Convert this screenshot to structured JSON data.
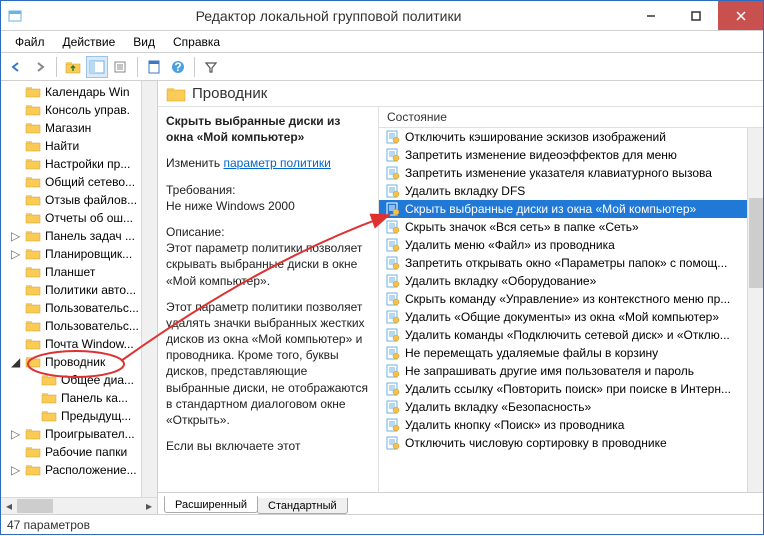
{
  "window": {
    "title": "Редактор локальной групповой политики"
  },
  "menu": {
    "file": "Файл",
    "action": "Действие",
    "view": "Вид",
    "help": "Справка"
  },
  "tree": {
    "items": [
      {
        "t": 0,
        "label": "Календарь Win"
      },
      {
        "t": 0,
        "label": "Консоль управ."
      },
      {
        "t": 0,
        "label": "Магазин"
      },
      {
        "t": 0,
        "label": "Найти"
      },
      {
        "t": 0,
        "label": "Настройки пр..."
      },
      {
        "t": 0,
        "label": "Общий сетево..."
      },
      {
        "t": 0,
        "label": "Отзыв файлов..."
      },
      {
        "t": 0,
        "label": "Отчеты об ош..."
      },
      {
        "t": 1,
        "label": "Панель задач ..."
      },
      {
        "t": 1,
        "label": "Планировщик..."
      },
      {
        "t": 0,
        "label": "Планшет"
      },
      {
        "t": 0,
        "label": "Политики авто..."
      },
      {
        "t": 0,
        "label": "Пользовательс..."
      },
      {
        "t": 0,
        "label": "Пользовательс..."
      },
      {
        "t": 0,
        "label": "Почта Window..."
      },
      {
        "t": 2,
        "label": "Проводник",
        "sel": true
      },
      {
        "t": 0,
        "label": "Общее диа...",
        "indent": true
      },
      {
        "t": 0,
        "label": "Панель ка...",
        "indent": true
      },
      {
        "t": 0,
        "label": "Предыдущ...",
        "indent": true
      },
      {
        "t": 1,
        "label": "Проигрывател..."
      },
      {
        "t": 0,
        "label": "Рабочие папки"
      },
      {
        "t": 1,
        "label": "Расположение..."
      }
    ]
  },
  "details": {
    "header": "Проводник",
    "policy_title": "Скрыть выбранные диски из окна «Мой компьютер»",
    "edit_label": "Изменить",
    "edit_link": "параметр политики",
    "req_label": "Требования:",
    "req_value": "Не ниже Windows 2000",
    "desc_label": "Описание:",
    "desc1": "Этот параметр политики позволяет скрывать выбранные диски в окне «Мой компьютер».",
    "desc2": "Этот параметр политики позволяет удалять значки выбранных жестких дисков из окна «Мой компьютер» и проводника. Кроме того, буквы дисков, представляющие выбранные диски, не отображаются в стандартном диалоговом окне «Открыть».",
    "desc3": "Если вы включаете этот"
  },
  "list": {
    "header": "Состояние",
    "items": [
      "Отключить кэширование эскизов изображений",
      "Запретить изменение видеоэффектов для меню",
      "Запретить изменение указателя клавиатурного вызова",
      "Удалить вкладку DFS",
      "Скрыть выбранные диски из окна «Мой компьютер»",
      "Скрыть значок «Вся сеть» в папке «Сеть»",
      "Удалить меню «Файл» из проводника",
      "Запретить открывать окно «Параметры папок» с помощ...",
      "Удалить вкладку «Оборудование»",
      "Скрыть команду «Управление» из контекстного меню пр...",
      "Удалить «Общие документы» из окна «Мой компьютер»",
      "Удалить команды «Подключить сетевой диск» и «Отклю...",
      "Не перемещать удаляемые файлы в корзину",
      "Не запрашивать другие имя пользователя и пароль",
      "Удалить ссылку «Повторить поиск» при поиске в Интерн...",
      "Удалить вкладку «Безопасность»",
      "Удалить кнопку «Поиск» из проводника",
      "Отключить числовую сортировку в проводнике"
    ],
    "selected_index": 4
  },
  "tabs": {
    "extended": "Расширенный",
    "standard": "Стандартный"
  },
  "status": {
    "text": "47 параметров"
  }
}
